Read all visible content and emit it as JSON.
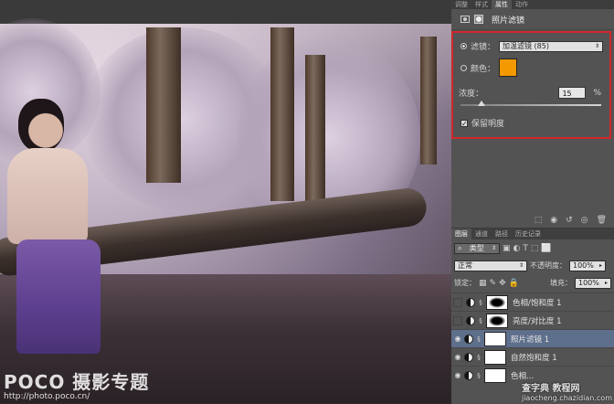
{
  "panel_tabs": [
    "调整",
    "样式",
    "属性",
    "动作"
  ],
  "properties": {
    "title": "照片滤镜",
    "filter_label": "滤镜：",
    "filter_value": "加温滤镜 (85)",
    "color_label": "颜色：",
    "color_value": "#f29a00",
    "density_label": "浓度：",
    "density_value": "15",
    "density_unit": "%",
    "density_level_percent": 15,
    "preserve_label": "保留明度",
    "preserve_checked": true
  },
  "layers_panel": {
    "tabs": [
      "图层",
      "通道",
      "路径",
      "历史记录"
    ],
    "filter_kind": "类型",
    "blend_mode": "正常",
    "opacity_label": "不透明度：",
    "opacity_value": "100%",
    "lock_label": "锁定：",
    "fill_label": "填充：",
    "fill_value": "100%",
    "layers": [
      {
        "name": "色相/饱和度 1",
        "visible": false,
        "selected": false
      },
      {
        "name": "亮度/对比度 1",
        "visible": false,
        "selected": false
      },
      {
        "name": "照片滤镜 1",
        "visible": true,
        "selected": true
      },
      {
        "name": "自然饱和度 1",
        "visible": true,
        "selected": false
      },
      {
        "name": "色相...",
        "visible": true,
        "selected": false
      }
    ]
  },
  "photo_watermark": {
    "brand": "POCO 摄影专题",
    "url": "http://photo.poco.cn/"
  },
  "site_watermark": {
    "line1": "查字典 教程网",
    "line2": "jiaocheng.chazidian.com"
  },
  "colors": {
    "accent_highlight": "#d3262a",
    "selection": "#5e6f8c"
  }
}
